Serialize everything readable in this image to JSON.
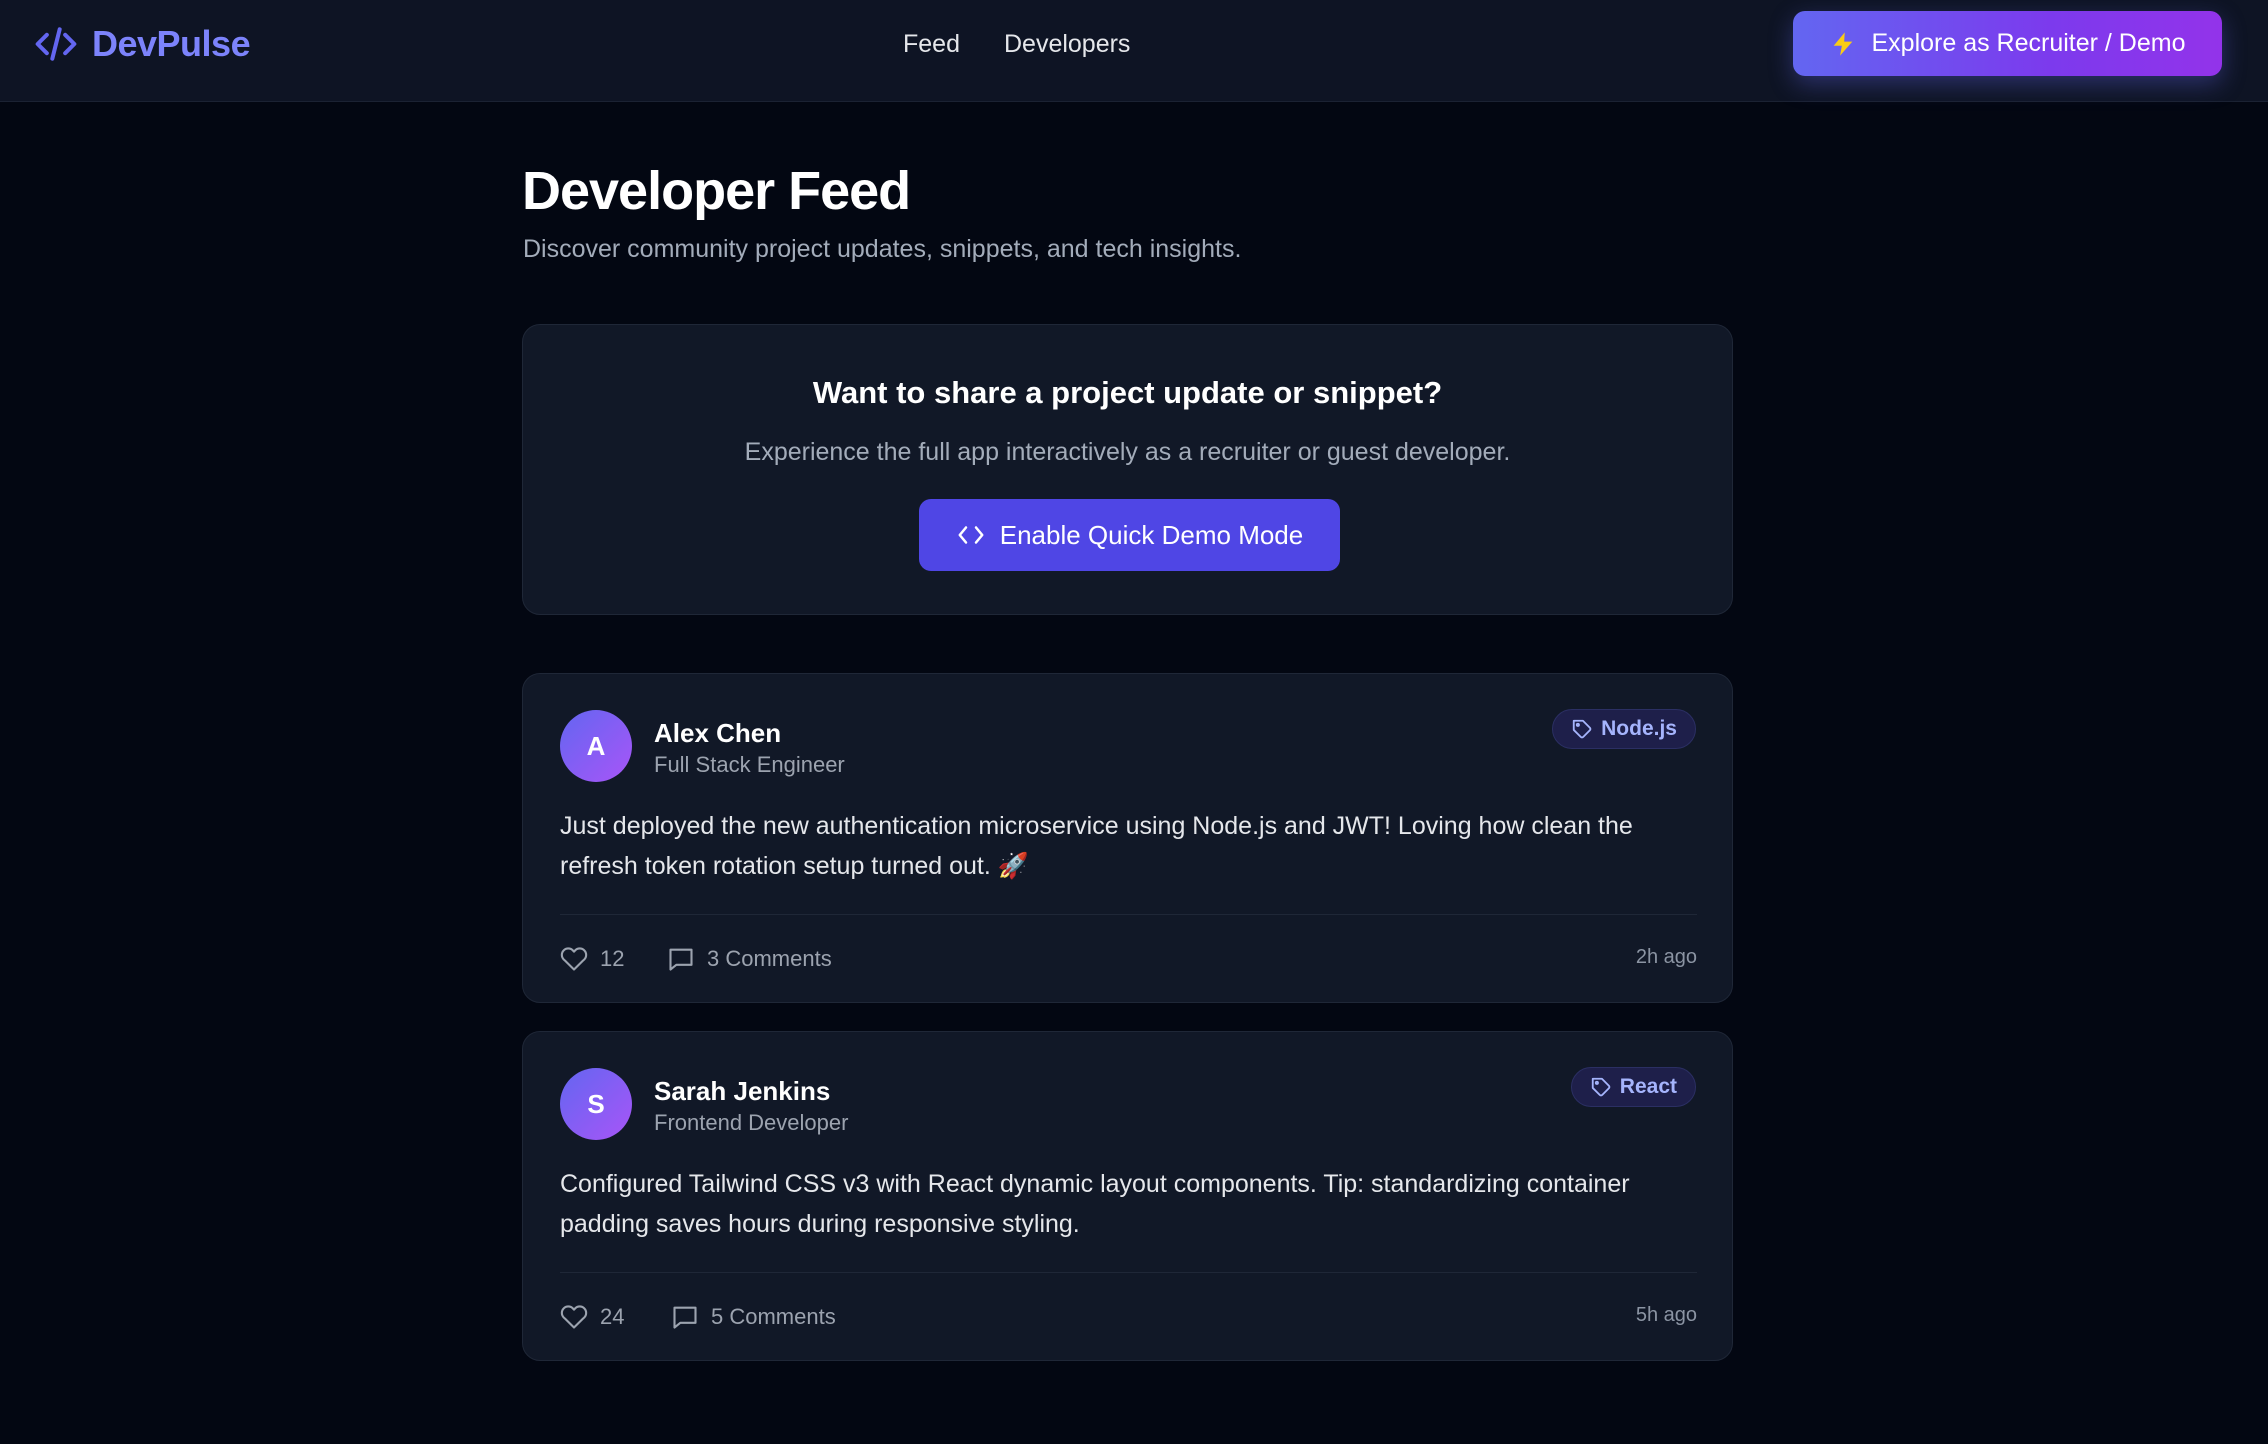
{
  "header": {
    "brand": "DevPulse",
    "brand_icon": "code-slash-icon",
    "nav": [
      {
        "label": "Feed"
      },
      {
        "label": "Developers"
      }
    ],
    "cta_label": "Explore as Recruiter / Demo",
    "cta_icon": "lightning-bolt-icon"
  },
  "page": {
    "title": "Developer Feed",
    "subtitle": "Discover community project updates, snippets, and tech insights."
  },
  "demo_card": {
    "heading": "Want to share a project update or snippet?",
    "text": "Experience the full app interactively as a recruiter or guest developer.",
    "button_label": "Enable Quick Demo Mode",
    "button_icon": "code-brackets-icon"
  },
  "posts": [
    {
      "avatar_initial": "A",
      "author": "Alex Chen",
      "role": "Full Stack Engineer",
      "tag": "Node.js",
      "body": "Just deployed the new authentication microservice using Node.js and JWT! Loving how clean the refresh token rotation setup turned out. 🚀",
      "likes": "12",
      "comments": "3 Comments",
      "time": "2h ago"
    },
    {
      "avatar_initial": "S",
      "author": "Sarah Jenkins",
      "role": "Frontend Developer",
      "tag": "React",
      "body": "Configured Tailwind CSS v3 with React dynamic layout components. Tip: standardizing container padding saves hours during responsive styling.",
      "likes": "24",
      "comments": "5 Comments",
      "time": "5h ago"
    }
  ],
  "colors": {
    "background": "#030712",
    "card": "#111827",
    "accent": "#4f46e5",
    "brand": "#7c83fb",
    "tag_text": "#a5b4fc"
  }
}
